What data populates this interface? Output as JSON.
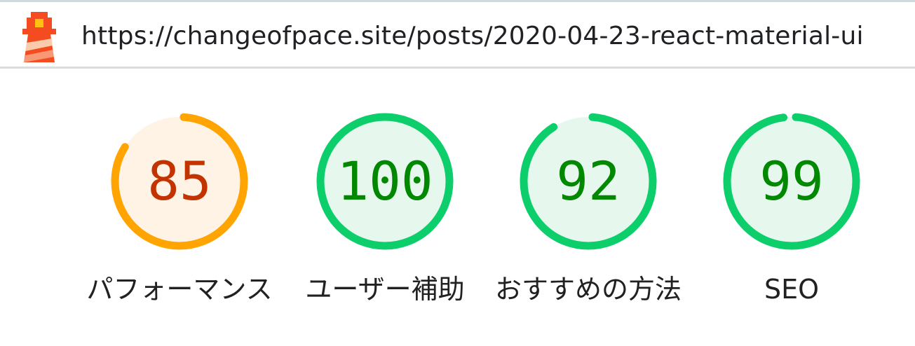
{
  "header": {
    "url": "https://changeofpace.site/posts/2020-04-23-react-material-ui",
    "logo_icon": "lighthouse-icon"
  },
  "colors": {
    "average_ring": "#ffa400",
    "average_fill": "#fff3e6",
    "average_text": "#c33300",
    "pass_ring": "#0cce6b",
    "pass_fill": "#e6f8ee",
    "pass_text": "#008800"
  },
  "gauges": [
    {
      "score": "85",
      "label": "パフォーマンス",
      "value": 85,
      "rating": "average"
    },
    {
      "score": "100",
      "label": "ユーザー補助",
      "value": 100,
      "rating": "pass"
    },
    {
      "score": "92",
      "label": "おすすめの方法",
      "value": 92,
      "rating": "pass"
    },
    {
      "score": "99",
      "label": "SEO",
      "value": 99,
      "rating": "pass"
    }
  ]
}
